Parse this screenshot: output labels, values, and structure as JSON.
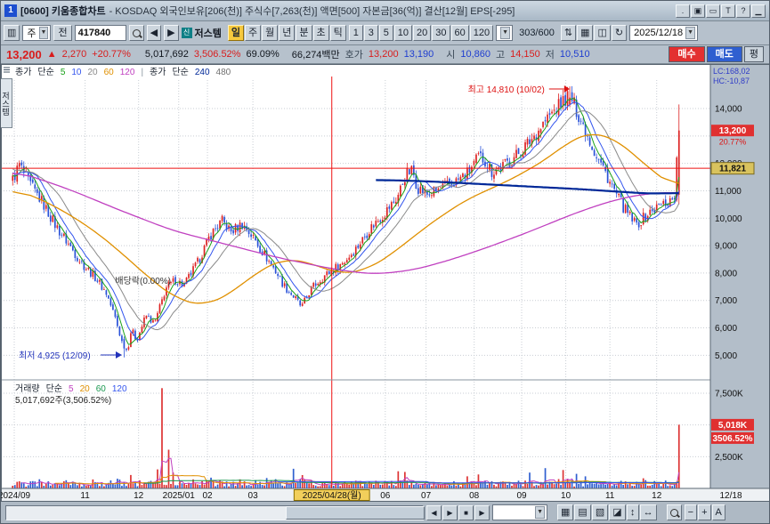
{
  "colors": {
    "up": "#dd2222",
    "down": "#2a52d8",
    "accent_red": "#ee1111",
    "price_box_bg": "#e03030",
    "ref_box_bg": "#d9c35e",
    "date_highlight_bg": "#f2cf5b",
    "active_period_bg": "#f6c93e"
  },
  "titlebar": {
    "badge": "1",
    "title": "[0600] 키움종합차트",
    "subtitle": "- KOSDAQ 외국인보유[206(천)] 주식수[7,263(천)] 액면[500] 자본금[36(억)] 결산[12월] EPS[-295]",
    "controls": [
      {
        "name": "menu-dot-icon",
        "glyph": "."
      },
      {
        "name": "copy-window-icon",
        "glyph": "▣"
      },
      {
        "name": "maximize-icon",
        "glyph": "▭"
      },
      {
        "name": "tool-t-icon",
        "glyph": "T"
      },
      {
        "name": "help-icon",
        "glyph": "?"
      },
      {
        "name": "minimize-icon",
        "glyph": "▁"
      }
    ]
  },
  "toolbar": {
    "chart_icon": "▥",
    "category": "주",
    "jeon": "전",
    "code": "417840",
    "badge": "신",
    "stock_name": "저스템",
    "periods": [
      {
        "label": "일",
        "active": true
      },
      {
        "label": "주",
        "active": false
      },
      {
        "label": "월",
        "active": false
      },
      {
        "label": "년",
        "active": false
      },
      {
        "label": "분",
        "active": false
      },
      {
        "label": "초",
        "active": false
      },
      {
        "label": "틱",
        "active": false
      }
    ],
    "minutes": [
      "1",
      "3",
      "5",
      "10",
      "20",
      "30",
      "60",
      "120"
    ],
    "range": "303/600",
    "icons": [
      {
        "name": "compare-icon",
        "glyph": "⇅"
      },
      {
        "name": "chart-grid-icon",
        "glyph": "▦"
      },
      {
        "name": "split-screen-icon",
        "glyph": "◫"
      },
      {
        "name": "refresh-icon",
        "glyph": "↻"
      }
    ],
    "date": "2025/12/18"
  },
  "quote": {
    "segments": [
      {
        "t": "13,200",
        "cls": "up big",
        "n": "current-price"
      },
      {
        "t": "▲",
        "cls": "up",
        "n": "change-arrow"
      },
      {
        "t": "2,270",
        "cls": "up",
        "n": "change-value"
      },
      {
        "t": "+20.77%",
        "cls": "up",
        "n": "change-percent"
      },
      {
        "t": "5,017,692",
        "cls": "dark",
        "n": "volume",
        "gap": 10
      },
      {
        "t": "3,506.52%",
        "cls": "up",
        "n": "volume-ratio"
      },
      {
        "t": "69.09%",
        "cls": "dark",
        "n": "strength"
      },
      {
        "t": "66,274백만",
        "cls": "dark",
        "n": "amount",
        "gap": 8
      },
      {
        "t": "호가",
        "cls": "lbl",
        "n": "hoga-label"
      },
      {
        "t": "13,200",
        "cls": "up",
        "n": "ask-price"
      },
      {
        "t": "13,190",
        "cls": "down",
        "n": "bid-price"
      },
      {
        "t": "시",
        "cls": "lbl",
        "n": "open-label",
        "gap": 8
      },
      {
        "t": "10,860",
        "cls": "down",
        "n": "open-price"
      },
      {
        "t": "고",
        "cls": "lbl",
        "n": "high-label"
      },
      {
        "t": "14,150",
        "cls": "up",
        "n": "high-price"
      },
      {
        "t": "저",
        "cls": "lbl",
        "n": "low-label"
      },
      {
        "t": "10,510",
        "cls": "down",
        "n": "low-price"
      }
    ],
    "buttons": [
      {
        "label": "매수",
        "style": "buy",
        "name": "buy-button"
      },
      {
        "label": "매도",
        "style": "sell",
        "name": "sell-button"
      },
      {
        "label": "평",
        "style": "plain",
        "name": "avg-button"
      }
    ]
  },
  "chart": {
    "tab": "저스템",
    "lc": "LC:168,02",
    "hc": "HC:-10,87",
    "price_legend": [
      {
        "t": "종가",
        "c": "#1c2430"
      },
      {
        "t": "단순",
        "c": "#1c2430"
      },
      {
        "t": "5",
        "c": "#18a018"
      },
      {
        "t": "10",
        "c": "#3355ee"
      },
      {
        "t": "20",
        "c": "#8a8a8a"
      },
      {
        "t": "60",
        "c": "#e09000"
      },
      {
        "t": "120",
        "c": "#c040c0"
      },
      {
        "t": "|",
        "c": "#8a95a0"
      },
      {
        "t": "종가",
        "c": "#1c2430"
      },
      {
        "t": "단순",
        "c": "#1c2430"
      },
      {
        "t": "240",
        "c": "#002898"
      },
      {
        "t": "480",
        "c": "#707070"
      }
    ],
    "volume_legend": [
      {
        "t": "거래량",
        "c": "#1c2430"
      },
      {
        "t": "단순",
        "c": "#1c2430"
      },
      {
        "t": "5",
        "c": "#c040c0"
      },
      {
        "t": "20",
        "c": "#e09000"
      },
      {
        "t": "60",
        "c": "#1a9850"
      },
      {
        "t": "120",
        "c": "#3355ee"
      }
    ],
    "volume_caption": "5,017,692주(3,506.52%)",
    "annotations": {
      "high": "최고 14,810 (10/02)",
      "low": "최저 4,925 (12/09)",
      "exdiv": "배당락(0.00%)"
    },
    "axis": {
      "price_ticks": [
        14000,
        12000,
        11000,
        10000,
        9000,
        8000,
        7000,
        6000,
        5000
      ],
      "price_box": {
        "v": 13200,
        "label": "13,200",
        "pct": "20.77%"
      },
      "ref_box": {
        "v": 11821,
        "label": "11,821"
      },
      "vol_ticks": [
        {
          "v": 7500,
          "label": "7,500K"
        },
        {
          "v": 2500,
          "label": "2,500K"
        }
      ],
      "vol_box": {
        "v": 5018,
        "label": "5,018K",
        "pct": "3506.52%"
      }
    },
    "hline": 11821,
    "crosshair_f": 0.479,
    "date_ticks": [
      {
        "f": 0.004,
        "label": "2024/09"
      },
      {
        "f": 0.11,
        "label": "11"
      },
      {
        "f": 0.19,
        "label": "12"
      },
      {
        "f": 0.25,
        "label": "2025/01"
      },
      {
        "f": 0.293,
        "label": "02"
      },
      {
        "f": 0.361,
        "label": "03"
      },
      {
        "f": 0.479,
        "label": "2025/04/28(월)",
        "highlight": true
      },
      {
        "f": 0.559,
        "label": "06"
      },
      {
        "f": 0.62,
        "label": "07"
      },
      {
        "f": 0.692,
        "label": "08"
      },
      {
        "f": 0.763,
        "label": "09"
      },
      {
        "f": 0.829,
        "label": "10"
      },
      {
        "f": 0.895,
        "label": "11"
      },
      {
        "f": 0.965,
        "label": "12"
      }
    ],
    "end_label": "12/18"
  },
  "chart_data": {
    "type": "candlestick+volume",
    "visible_candles": 300,
    "price_range": [
      4200,
      15040
    ],
    "pre_anchors": [
      [
        -0.12,
        12600
      ],
      [
        -0.06,
        12100
      ],
      [
        -0.02,
        11700
      ]
    ],
    "close_anchors": [
      [
        0.0,
        11400
      ],
      [
        0.01,
        11950
      ],
      [
        0.024,
        11300
      ],
      [
        0.044,
        10600
      ],
      [
        0.064,
        9750
      ],
      [
        0.084,
        9050
      ],
      [
        0.104,
        8350
      ],
      [
        0.124,
        7850
      ],
      [
        0.141,
        7250
      ],
      [
        0.154,
        6350
      ],
      [
        0.165,
        5400
      ],
      [
        0.172,
        5150
      ],
      [
        0.178,
        5950
      ],
      [
        0.186,
        5550
      ],
      [
        0.2,
        6450
      ],
      [
        0.213,
        6150
      ],
      [
        0.23,
        7450
      ],
      [
        0.244,
        7750
      ],
      [
        0.257,
        7550
      ],
      [
        0.277,
        8350
      ],
      [
        0.297,
        9400
      ],
      [
        0.314,
        9900
      ],
      [
        0.328,
        9500
      ],
      [
        0.344,
        9800
      ],
      [
        0.361,
        9300
      ],
      [
        0.377,
        8700
      ],
      [
        0.394,
        8100
      ],
      [
        0.407,
        7550
      ],
      [
        0.423,
        7100
      ],
      [
        0.434,
        6750
      ],
      [
        0.447,
        7400
      ],
      [
        0.463,
        7800
      ],
      [
        0.479,
        8100
      ],
      [
        0.497,
        8400
      ],
      [
        0.517,
        8950
      ],
      [
        0.537,
        9650
      ],
      [
        0.557,
        10150
      ],
      [
        0.577,
        10750
      ],
      [
        0.59,
        11600
      ],
      [
        0.6,
        11750
      ],
      [
        0.607,
        11150
      ],
      [
        0.623,
        10850
      ],
      [
        0.643,
        11100
      ],
      [
        0.663,
        11300
      ],
      [
        0.683,
        11650
      ],
      [
        0.7,
        12250
      ],
      [
        0.71,
        12100
      ],
      [
        0.719,
        11700
      ],
      [
        0.736,
        11900
      ],
      [
        0.756,
        12300
      ],
      [
        0.776,
        12800
      ],
      [
        0.796,
        13450
      ],
      [
        0.812,
        13900
      ],
      [
        0.827,
        14300
      ],
      [
        0.836,
        14500
      ],
      [
        0.847,
        13900
      ],
      [
        0.86,
        13200
      ],
      [
        0.873,
        12450
      ],
      [
        0.887,
        11800
      ],
      [
        0.903,
        11000
      ],
      [
        0.919,
        10300
      ],
      [
        0.936,
        9750
      ],
      [
        0.951,
        10100
      ],
      [
        0.967,
        10400
      ],
      [
        0.983,
        10600
      ],
      [
        0.993,
        10750
      ],
      [
        1.0,
        13200
      ]
    ],
    "markers": {
      "high": {
        "f": 0.836,
        "price": 14810,
        "date": "10/02"
      },
      "low": {
        "f": 0.168,
        "price": 4925,
        "date": "12/09"
      },
      "last": {
        "open": 10860,
        "high": 14150,
        "low": 10510,
        "close": 13200,
        "volume_k": 5018
      }
    },
    "volume_spikes": [
      [
        0.218,
        1500
      ],
      [
        0.2255,
        7900
      ],
      [
        0.233,
        3050
      ],
      [
        0.24,
        1250
      ],
      [
        0.297,
        850
      ],
      [
        0.423,
        1550
      ],
      [
        0.434,
        1050
      ],
      [
        0.577,
        1350
      ],
      [
        0.59,
        1300
      ],
      [
        0.683,
        950
      ],
      [
        0.7,
        1100
      ],
      [
        0.776,
        1250
      ],
      [
        0.8,
        1600
      ],
      [
        0.827,
        1450
      ],
      [
        0.847,
        1150
      ],
      [
        0.86,
        950
      ],
      [
        1.0,
        5018
      ]
    ],
    "ma60": [
      [
        0,
        11100
      ],
      [
        0.06,
        10500
      ],
      [
        0.12,
        9600
      ],
      [
        0.17,
        8600
      ],
      [
        0.21,
        7700
      ],
      [
        0.25,
        7000
      ],
      [
        0.29,
        6800
      ],
      [
        0.33,
        7300
      ],
      [
        0.37,
        8100
      ],
      [
        0.41,
        8550
      ],
      [
        0.45,
        8350
      ],
      [
        0.49,
        7950
      ],
      [
        0.53,
        8100
      ],
      [
        0.57,
        8700
      ],
      [
        0.61,
        9500
      ],
      [
        0.65,
        10200
      ],
      [
        0.69,
        10800
      ],
      [
        0.73,
        11200
      ],
      [
        0.77,
        11700
      ],
      [
        0.81,
        12300
      ],
      [
        0.84,
        12900
      ],
      [
        0.87,
        13150
      ],
      [
        0.9,
        12950
      ],
      [
        0.93,
        12400
      ],
      [
        0.96,
        11700
      ],
      [
        1.0,
        11050
      ]
    ],
    "ma120": [
      [
        0,
        11750
      ],
      [
        0.08,
        11100
      ],
      [
        0.16,
        10300
      ],
      [
        0.24,
        9550
      ],
      [
        0.32,
        9050
      ],
      [
        0.4,
        8550
      ],
      [
        0.48,
        8150
      ],
      [
        0.54,
        7950
      ],
      [
        0.6,
        8100
      ],
      [
        0.66,
        8500
      ],
      [
        0.72,
        9000
      ],
      [
        0.78,
        9550
      ],
      [
        0.84,
        10150
      ],
      [
        0.9,
        10650
      ],
      [
        0.95,
        10900
      ],
      [
        1.0,
        10950
      ]
    ],
    "ma240": [
      [
        0.545,
        11400
      ],
      [
        0.62,
        11350
      ],
      [
        0.7,
        11250
      ],
      [
        0.78,
        11150
      ],
      [
        0.86,
        11050
      ],
      [
        0.92,
        10950
      ],
      [
        0.97,
        10880
      ],
      [
        1.0,
        10950
      ]
    ]
  },
  "bottom": {
    "nav": [
      {
        "name": "scroll-left-button",
        "glyph": "◀"
      },
      {
        "name": "scroll-right-button",
        "glyph": "▶"
      },
      {
        "name": "stop-button",
        "glyph": "■"
      },
      {
        "name": "play-button",
        "glyph": "▶"
      }
    ],
    "icons": [
      {
        "name": "grid-icon",
        "glyph": "▦"
      },
      {
        "name": "panel-layout-icon",
        "glyph": "▤"
      },
      {
        "name": "pattern-tool-icon",
        "glyph": "▧"
      },
      {
        "name": "shape-tool-icon",
        "glyph": "◪"
      },
      {
        "name": "fit-vertical-icon",
        "glyph": "↕"
      },
      {
        "name": "fit-horizontal-icon",
        "glyph": "↔"
      }
    ],
    "zoom": [
      {
        "name": "zoom-out-button",
        "glyph": "−"
      },
      {
        "name": "zoom-in-button",
        "glyph": "+"
      },
      {
        "name": "font-size-button",
        "glyph": "A"
      }
    ]
  }
}
